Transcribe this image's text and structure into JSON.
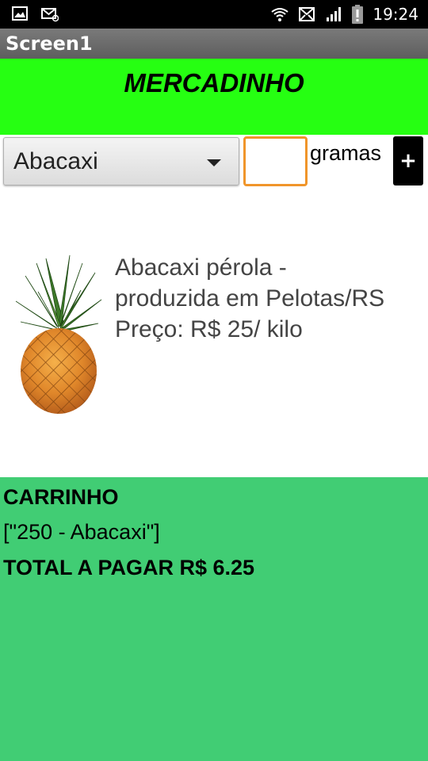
{
  "status_bar": {
    "time": "19:24",
    "icons": [
      "image-icon",
      "mail-icon",
      "wifi-icon",
      "email-icon",
      "signal-icon",
      "alert-icon",
      "battery-icon"
    ]
  },
  "app_bar": {
    "title": "Screen1"
  },
  "header": {
    "title": "MERCADINHO",
    "background": "#26ff12"
  },
  "controls": {
    "product_selected": "Abacaxi",
    "quantity_value": "",
    "quantity_placeholder": "",
    "unit_label": "gramas",
    "add_label": "+"
  },
  "product": {
    "image_icon": "pineapple-image",
    "description_lines": [
      "Abacaxi pérola -",
      "produzida em Pelotas/RS",
      "Preço: R$ 25/ kilo"
    ]
  },
  "cart": {
    "title": "CARRINHO",
    "items": "[\"250 - Abacaxi\"]",
    "total": "TOTAL A PAGAR R$ 6.25",
    "background": "#41cd74"
  }
}
